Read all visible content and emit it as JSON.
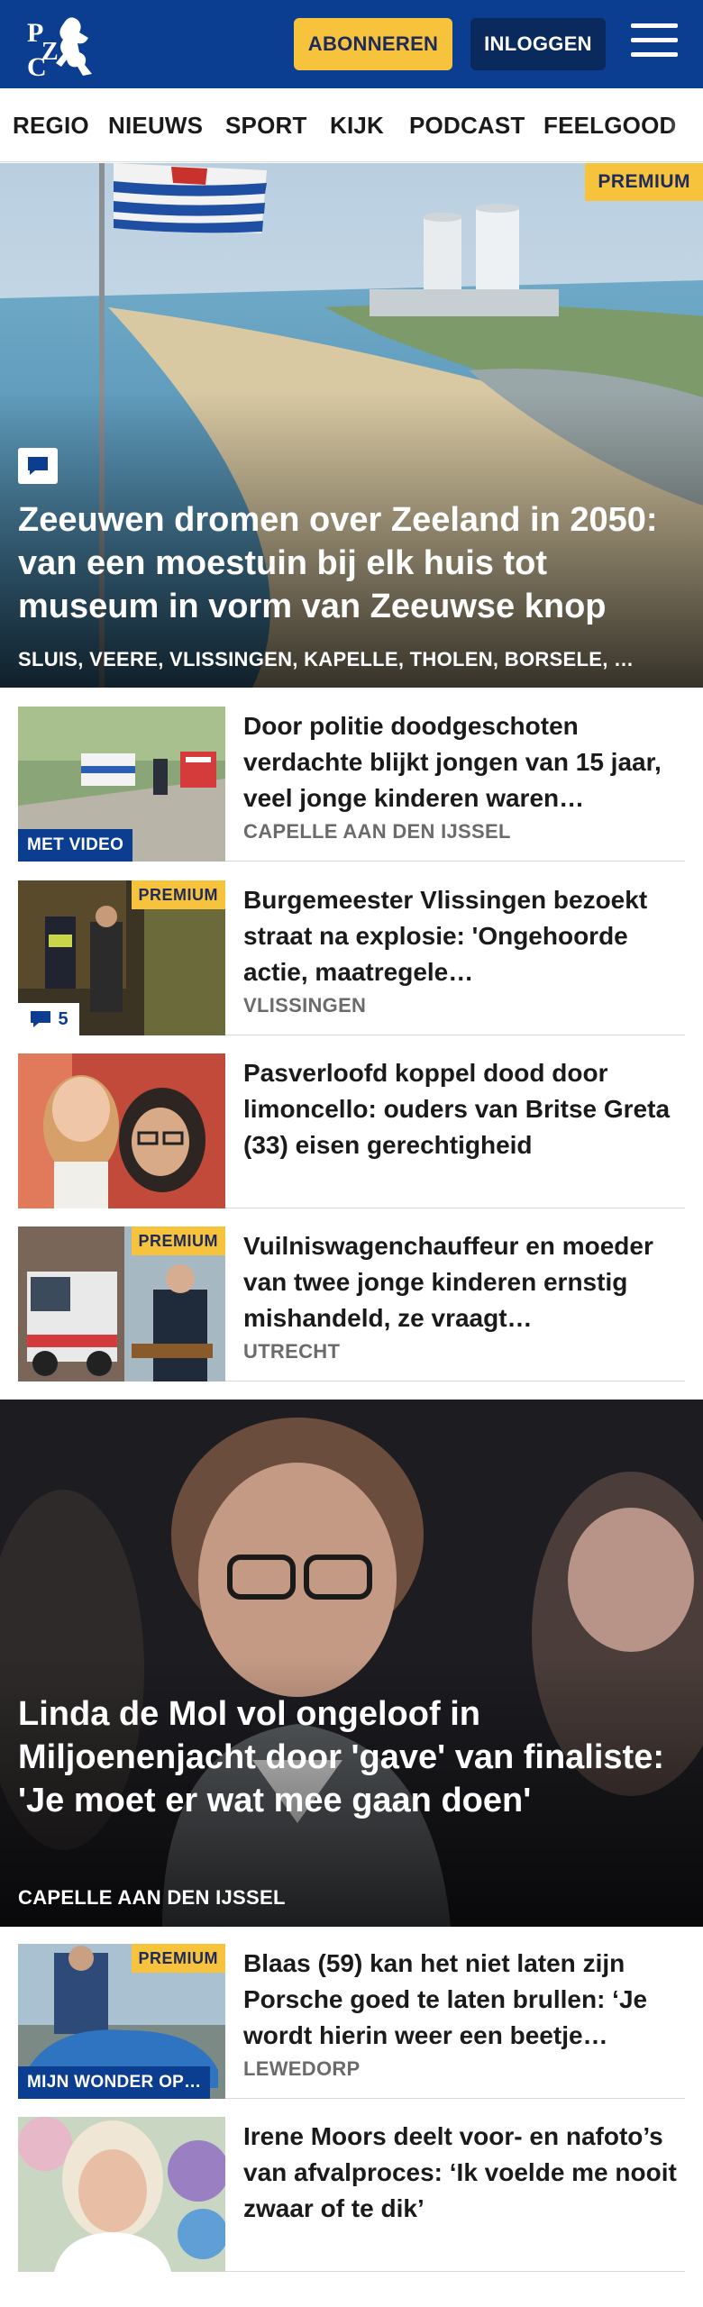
{
  "header": {
    "logo_text": "PZC",
    "subscribe_label": "ABONNEREN",
    "login_label": "INLOGGEN",
    "brand_color": "#0b3d91",
    "accent_color": "#f7c33c",
    "menu_icon": "hamburger-menu-icon"
  },
  "nav": {
    "items": [
      "REGIO",
      "NIEUWS",
      "SPORT",
      "KIJK",
      "PODCAST",
      "FEELGOOD"
    ]
  },
  "hero": {
    "badge": "PREMIUM",
    "icon": "comment-icon",
    "title": "Zeeuwen dromen over Zeeland in 2050: van een moestuin bij elk huis tot museum in vorm van Zeeuwse knop",
    "tags": "SLUIS, VEERE, VLISSINGEN, KAPELLE, THOLEN, BORSELE, …"
  },
  "articles": [
    {
      "title": "Door politie doodgeschoten verdachte blijkt jongen van 15 jaar, veel jonge kinderen waren…",
      "location": "CAPELLE AAN DEN IJSSEL",
      "badge": "MET VIDEO"
    },
    {
      "title": "Burgemeester Vlissingen bezoekt straat na explosie: 'Ongehoorde actie, maatregele…",
      "location": "VLISSINGEN",
      "badge": "PREMIUM",
      "comments": "5"
    },
    {
      "title": "Pasverloofd koppel dood door limoncello: ouders van Britse Greta (33) eisen gerechtigheid",
      "location": ""
    },
    {
      "title": "Vuilniswagenchauffeur en moeder van twee jonge kinderen ernstig mishandeld, ze vraagt…",
      "location": "UTRECHT",
      "badge": "PREMIUM"
    }
  ],
  "hero2": {
    "title": "Linda de Mol vol ongeloof in Miljoenenjacht door 'gave' van finaliste: 'Je moet er wat mee gaan doen'",
    "location": "CAPELLE AAN DEN IJSSEL"
  },
  "articles2": [
    {
      "title": "Blaas (59) kan het niet laten zijn Porsche goed te laten brullen: ‘Je wordt hierin weer een beetje…",
      "location": "LEWEDORP",
      "badge": "PREMIUM",
      "badge2": "MIJN WONDER OP…"
    },
    {
      "title": "Irene Moors deelt voor- en nafoto’s van afvalproces: ‘Ik voelde me nooit zwaar of te dik’",
      "location": ""
    }
  ]
}
